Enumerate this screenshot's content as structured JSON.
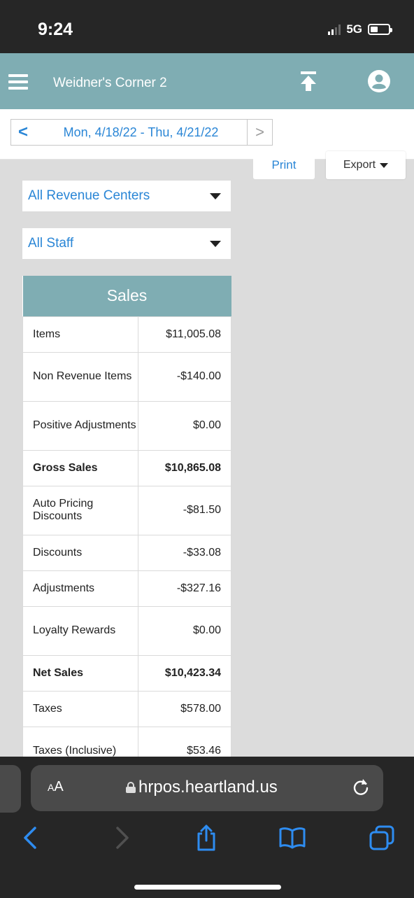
{
  "status_bar": {
    "time": "9:24",
    "network": "5G"
  },
  "app_bar": {
    "title": "Weidner's Corner 2",
    "icons": [
      "menu-icon",
      "upload-icon",
      "account-icon"
    ]
  },
  "date_nav": {
    "prev": "<",
    "range": "Mon, 4/18/22 - Thu, 4/21/22",
    "next": ">"
  },
  "actions": {
    "print": "Print",
    "export": "Export"
  },
  "filters": {
    "revenue_center": "All Revenue Centers",
    "staff": "All Staff"
  },
  "sales": {
    "title": "Sales",
    "rows": [
      {
        "label": "Items",
        "value": "$11,005.08"
      },
      {
        "label": "Non Revenue Items",
        "value": "-$140.00"
      },
      {
        "label": "Positive Adjustments",
        "value": "$0.00"
      },
      {
        "label": "Gross Sales",
        "value": "$10,865.08"
      },
      {
        "label": "Auto Pricing Discounts",
        "value": "-$81.50"
      },
      {
        "label": "Discounts",
        "value": "-$33.08"
      },
      {
        "label": "Adjustments",
        "value": "-$327.16"
      },
      {
        "label": "Loyalty Rewards",
        "value": "$0.00"
      },
      {
        "label": "Net Sales",
        "value": "$10,423.34"
      },
      {
        "label": "Taxes",
        "value": "$578.00"
      },
      {
        "label": "Taxes (Inclusive)",
        "value": "$53.46"
      }
    ]
  },
  "browser": {
    "aa_big": "A",
    "aa_small": "A",
    "url": "hrpos.heartland.us",
    "icons": [
      "back-icon",
      "forward-icon",
      "share-icon",
      "bookmarks-icon",
      "tabs-icon",
      "reload-icon",
      "lock-icon"
    ]
  },
  "colors": {
    "accent_teal": "#7fadb3",
    "link_blue": "#2a86d6",
    "dark_chrome": "#262626"
  }
}
